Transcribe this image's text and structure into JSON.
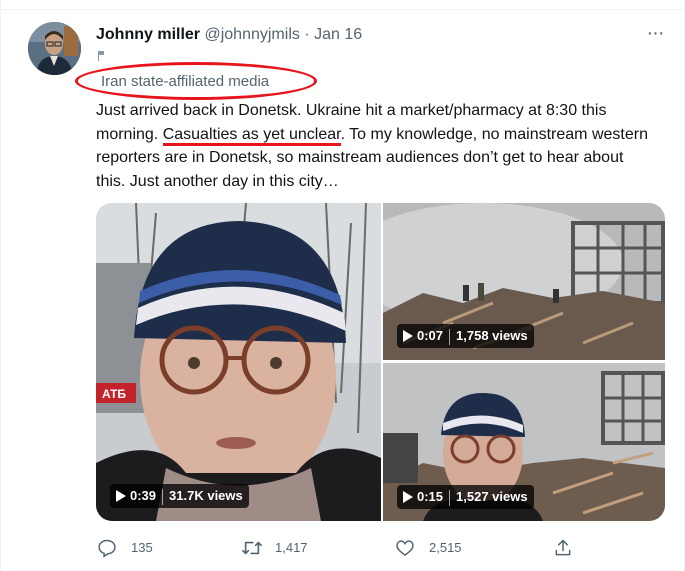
{
  "tweet": {
    "author_name": "Johnny miller",
    "handle": "@johnnyjmils",
    "separator": "·",
    "date": "Jan 16",
    "more_label": "···",
    "affiliation": "Iran state-affiliated media",
    "text_part1": "Just arrived back in Donetsk. Ukraine hit a market/pharmacy at 8:30 this morning. ",
    "text_highlight": "Casualties as yet unclear",
    "text_part2": ". To my knowledge, no mainstream western reporters are in Donetsk, so mainstream audiences don’t get to hear about this. Just another day in this city…"
  },
  "media": {
    "left": {
      "duration": "0:39",
      "views": "31.7K views",
      "overlay_text": "АТБ"
    },
    "top_right": {
      "duration": "0:07",
      "views": "1,758 views"
    },
    "bottom_right": {
      "duration": "0:15",
      "views": "1,527 views"
    }
  },
  "actions": {
    "replies": "135",
    "retweets": "1,417",
    "likes": "2,515"
  },
  "colors": {
    "annotation_red": "#e8141c",
    "text_primary": "#0f1419",
    "text_secondary": "#536471"
  }
}
